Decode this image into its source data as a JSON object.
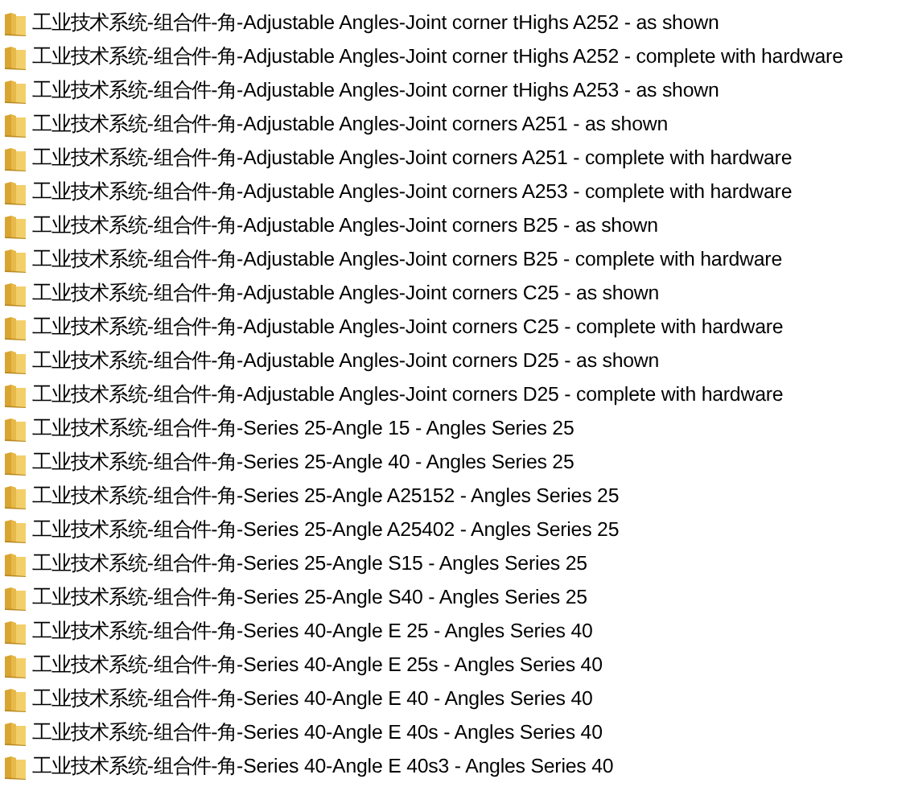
{
  "items": [
    {
      "name": "工业技术系统-组合件-角-Adjustable Angles-Joint corner tHighs A252 - as shown"
    },
    {
      "name": "工业技术系统-组合件-角-Adjustable Angles-Joint corner tHighs A252 - complete with hardware"
    },
    {
      "name": "工业技术系统-组合件-角-Adjustable Angles-Joint corner tHighs A253 - as shown"
    },
    {
      "name": "工业技术系统-组合件-角-Adjustable Angles-Joint corners A251 - as shown"
    },
    {
      "name": "工业技术系统-组合件-角-Adjustable Angles-Joint corners A251 - complete with hardware"
    },
    {
      "name": "工业技术系统-组合件-角-Adjustable Angles-Joint corners A253 - complete with hardware"
    },
    {
      "name": "工业技术系统-组合件-角-Adjustable Angles-Joint corners B25 - as shown"
    },
    {
      "name": "工业技术系统-组合件-角-Adjustable Angles-Joint corners B25 - complete with hardware"
    },
    {
      "name": "工业技术系统-组合件-角-Adjustable Angles-Joint corners C25 - as shown"
    },
    {
      "name": "工业技术系统-组合件-角-Adjustable Angles-Joint corners C25 - complete with hardware"
    },
    {
      "name": "工业技术系统-组合件-角-Adjustable Angles-Joint corners D25 - as shown"
    },
    {
      "name": "工业技术系统-组合件-角-Adjustable Angles-Joint corners D25 - complete with hardware"
    },
    {
      "name": "工业技术系统-组合件-角-Series 25-Angle 15 - Angles Series 25"
    },
    {
      "name": "工业技术系统-组合件-角-Series 25-Angle 40 - Angles Series 25"
    },
    {
      "name": "工业技术系统-组合件-角-Series 25-Angle A25152 - Angles Series 25"
    },
    {
      "name": "工业技术系统-组合件-角-Series 25-Angle A25402 - Angles Series 25"
    },
    {
      "name": "工业技术系统-组合件-角-Series 25-Angle S15 - Angles Series 25"
    },
    {
      "name": "工业技术系统-组合件-角-Series 25-Angle S40 - Angles Series 25"
    },
    {
      "name": "工业技术系统-组合件-角-Series 40-Angle E 25 - Angles Series 40"
    },
    {
      "name": "工业技术系统-组合件-角-Series 40-Angle E 25s - Angles Series 40"
    },
    {
      "name": "工业技术系统-组合件-角-Series 40-Angle E 40 - Angles Series 40"
    },
    {
      "name": "工业技术系统-组合件-角-Series 40-Angle E 40s - Angles Series 40"
    },
    {
      "name": "工业技术系统-组合件-角-Series 40-Angle E 40s3 - Angles Series 40"
    }
  ]
}
